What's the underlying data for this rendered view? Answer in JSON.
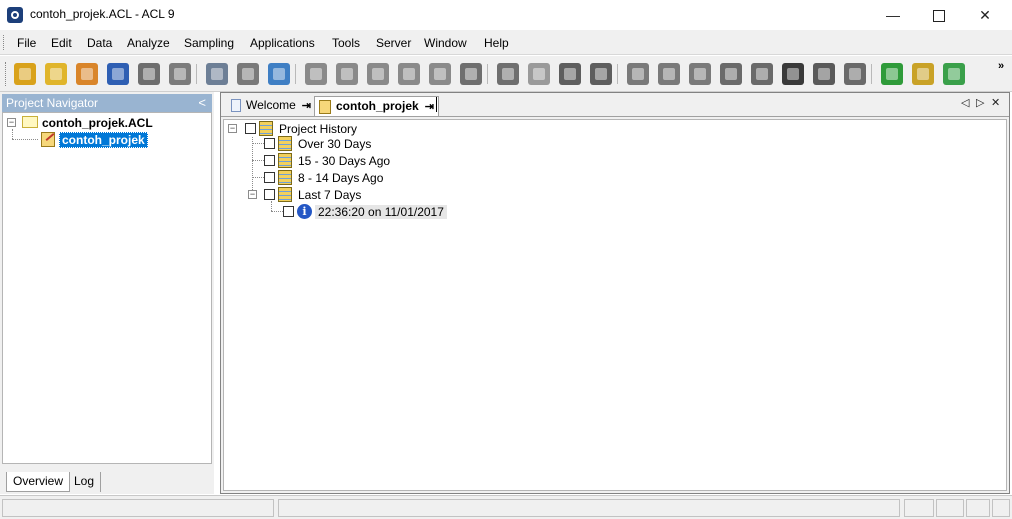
{
  "window": {
    "title": "contoh_projek.ACL - ACL 9",
    "minimize_label": "—",
    "close_label": "✕"
  },
  "menu": [
    "File",
    "Edit",
    "Data",
    "Analyze",
    "Sampling",
    "Applications",
    "Tools",
    "Server",
    "Window",
    "Help"
  ],
  "toolbar": {
    "icons": [
      {
        "name": "open-project-icon",
        "color": "#d9a21b"
      },
      {
        "name": "open-table-icon",
        "color": "#e0b52c"
      },
      {
        "name": "close-table-icon",
        "color": "#d9852a"
      },
      {
        "name": "save-icon",
        "color": "#2f5fb3"
      },
      {
        "name": "print-icon",
        "color": "#6e6e6e"
      },
      {
        "name": "print-preview-icon",
        "color": "#7c7c7c"
      },
      {
        "name": "refresh-icon",
        "color": "#6d7f96"
      },
      {
        "name": "table-layout-icon",
        "color": "#7a7a7a"
      },
      {
        "name": "filter-icon",
        "color": "#3f7fc4"
      },
      {
        "name": "copy-icon",
        "color": "#8a8a8a"
      },
      {
        "name": "edit-view-icon",
        "color": "#8a8a8a"
      },
      {
        "name": "add-column-icon",
        "color": "#8a8a8a"
      },
      {
        "name": "modify-column-icon",
        "color": "#8a8a8a"
      },
      {
        "name": "remove-column-icon",
        "color": "#8a8a8a"
      },
      {
        "name": "font-icon",
        "color": "#6f6f6f"
      },
      {
        "name": "verify-icon",
        "color": "#6f6f6f"
      },
      {
        "name": "stratify-icon",
        "color": "#9a9a9a"
      },
      {
        "name": "total-icon",
        "color": "#5e5e5e"
      },
      {
        "name": "percent-icon",
        "color": "#5e5e5e"
      },
      {
        "name": "classify-icon",
        "color": "#7a7a7a"
      },
      {
        "name": "split-icon",
        "color": "#7a7a7a"
      },
      {
        "name": "extract-icon",
        "color": "#7a7a7a"
      },
      {
        "name": "sequence-icon",
        "color": "#6a6a6a"
      },
      {
        "name": "spell-check-icon",
        "color": "#6a6a6a"
      },
      {
        "name": "statistics-icon",
        "color": "#3a3a3a"
      },
      {
        "name": "benford-icon",
        "color": "#5a5a5a"
      },
      {
        "name": "script-editor-icon",
        "color": "#6a6a6a"
      },
      {
        "name": "command-icon",
        "color": "#2f9b3a"
      },
      {
        "name": "user-icon",
        "color": "#c9a227"
      },
      {
        "name": "windows-icon",
        "color": "#3aa04a"
      }
    ],
    "more_label": "»"
  },
  "navigator": {
    "header": "Project Navigator",
    "collapse_label": "<",
    "project_name": "contoh_projek.ACL",
    "item_name": "contoh_projek",
    "tabs": [
      "Overview",
      "Log"
    ]
  },
  "document_tabs": {
    "welcome_label": "Welcome",
    "project_label": "contoh_projek",
    "pin_label": "⇥",
    "scroll_left": "◁",
    "scroll_right": "▷",
    "close_label": "✕"
  },
  "history": {
    "root": "Project History",
    "groups": [
      "Over 30 Days",
      "15 - 30 Days Ago",
      "8 - 14 Days Ago",
      "Last 7 Days"
    ],
    "entry": "22:36:20 on 11/01/2017",
    "entry_icon_glyph": "i"
  }
}
